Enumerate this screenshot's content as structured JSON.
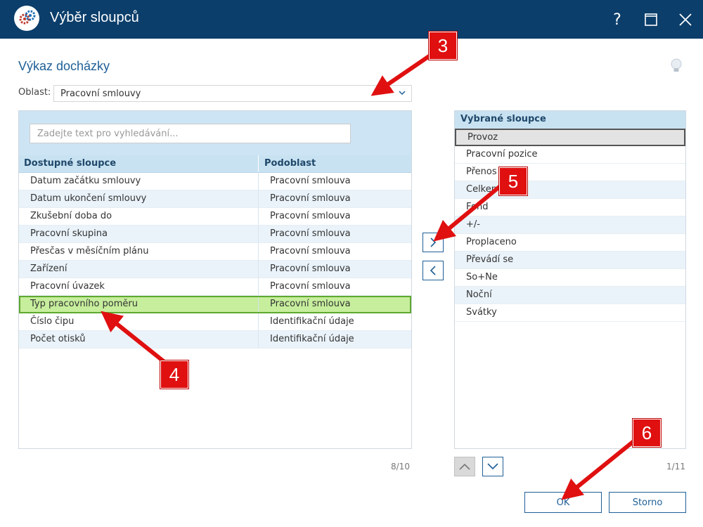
{
  "window": {
    "title": "Výběr sloupců",
    "help_label": "?",
    "accent": "#0b3e6b"
  },
  "page": {
    "title": "Výkaz docházky",
    "bulb_icon": "lightbulb-icon"
  },
  "oblast": {
    "label": "Oblast:",
    "value": "Pracovní smlouvy"
  },
  "search": {
    "placeholder": "Zadejte text pro vyhledávání..."
  },
  "available": {
    "headers": [
      "Dostupné sloupce",
      "Podoblast"
    ],
    "rows": [
      {
        "name": "Datum začátku smlouvy",
        "sub": "Pracovní smlouva"
      },
      {
        "name": "Datum ukončení smlouvy",
        "sub": "Pracovní smlouva"
      },
      {
        "name": "Zkušební doba do",
        "sub": "Pracovní smlouva"
      },
      {
        "name": "Pracovní skupina",
        "sub": "Pracovní smlouva"
      },
      {
        "name": "Přesčas v měsíčním plánu",
        "sub": "Pracovní smlouva"
      },
      {
        "name": "Zařízení",
        "sub": "Pracovní smlouva"
      },
      {
        "name": "Pracovní úvazek",
        "sub": "Pracovní smlouva"
      },
      {
        "name": "Typ pracovního poměru",
        "sub": "Pracovní smlouva"
      },
      {
        "name": "Číslo čipu",
        "sub": "Identifikační údaje"
      },
      {
        "name": "Počet otisků",
        "sub": "Identifikační údaje"
      }
    ],
    "count": "8/10"
  },
  "selected": {
    "header": "Vybrané sloupce",
    "rows": [
      "Provoz",
      "Pracovní pozice",
      "Přenos",
      "Celkem",
      "Fond",
      "+/-",
      "Proplaceno",
      "Převádí se",
      "So+Ne",
      "Noční",
      "Svátky"
    ],
    "count": "1/11"
  },
  "buttons": {
    "ok": "OK",
    "cancel": "Storno"
  },
  "annotations": [
    "3",
    "4",
    "5",
    "6"
  ],
  "colors": {
    "selection_fill": "#c6ee9c",
    "annotation_red": "#e01010"
  }
}
